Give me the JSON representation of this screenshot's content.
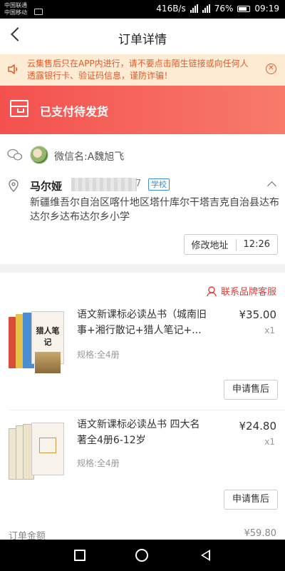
{
  "status_bar": {
    "carrier_1": "中国联通",
    "carrier_2": "中国移动",
    "net_speed": "416B/s",
    "battery": "76%",
    "time": "09:19"
  },
  "header": {
    "title": "订单详情"
  },
  "notice": {
    "text": "云集售后只在APP内进行，请不要点击陌生链接或向任何人透露银行卡、验证码信息，谨防诈骗！",
    "close_icon": "close-circle-icon"
  },
  "order_status": {
    "text": "已支付待发货"
  },
  "buyer": {
    "wechat_label": "微信名:A魏旭飞"
  },
  "address": {
    "name": "马尔娅",
    "phone_tail": "7",
    "tag": "学校",
    "full": "新疆维吾尔自治区喀什地区塔什库尔干塔吉克自治县达布达尔乡达布达尔乡小学",
    "modify_label": "修改地址",
    "time_label": "12:26"
  },
  "service": {
    "label": "联系品牌客服"
  },
  "items": [
    {
      "title": "语文新课标必读丛书（城南旧事+湘行散记+猎人笔记+...",
      "price": "¥35.00",
      "qty": "x1",
      "spec": "规格:全4册",
      "action": "申请售后",
      "cover_text": "猎人笔记"
    },
    {
      "title": "语文新课标必读丛书 四大名著全4册6-12岁",
      "price": "¥24.80",
      "qty": "x1",
      "spec": "规格:全4册",
      "action": "申请售后"
    }
  ],
  "summary": {
    "amount_label": "订单金额",
    "amount_value": "¥59.80"
  },
  "colors": {
    "accent": "#f4514f",
    "notice_bg": "#fdebd3",
    "notice_text": "#e15a2a"
  }
}
